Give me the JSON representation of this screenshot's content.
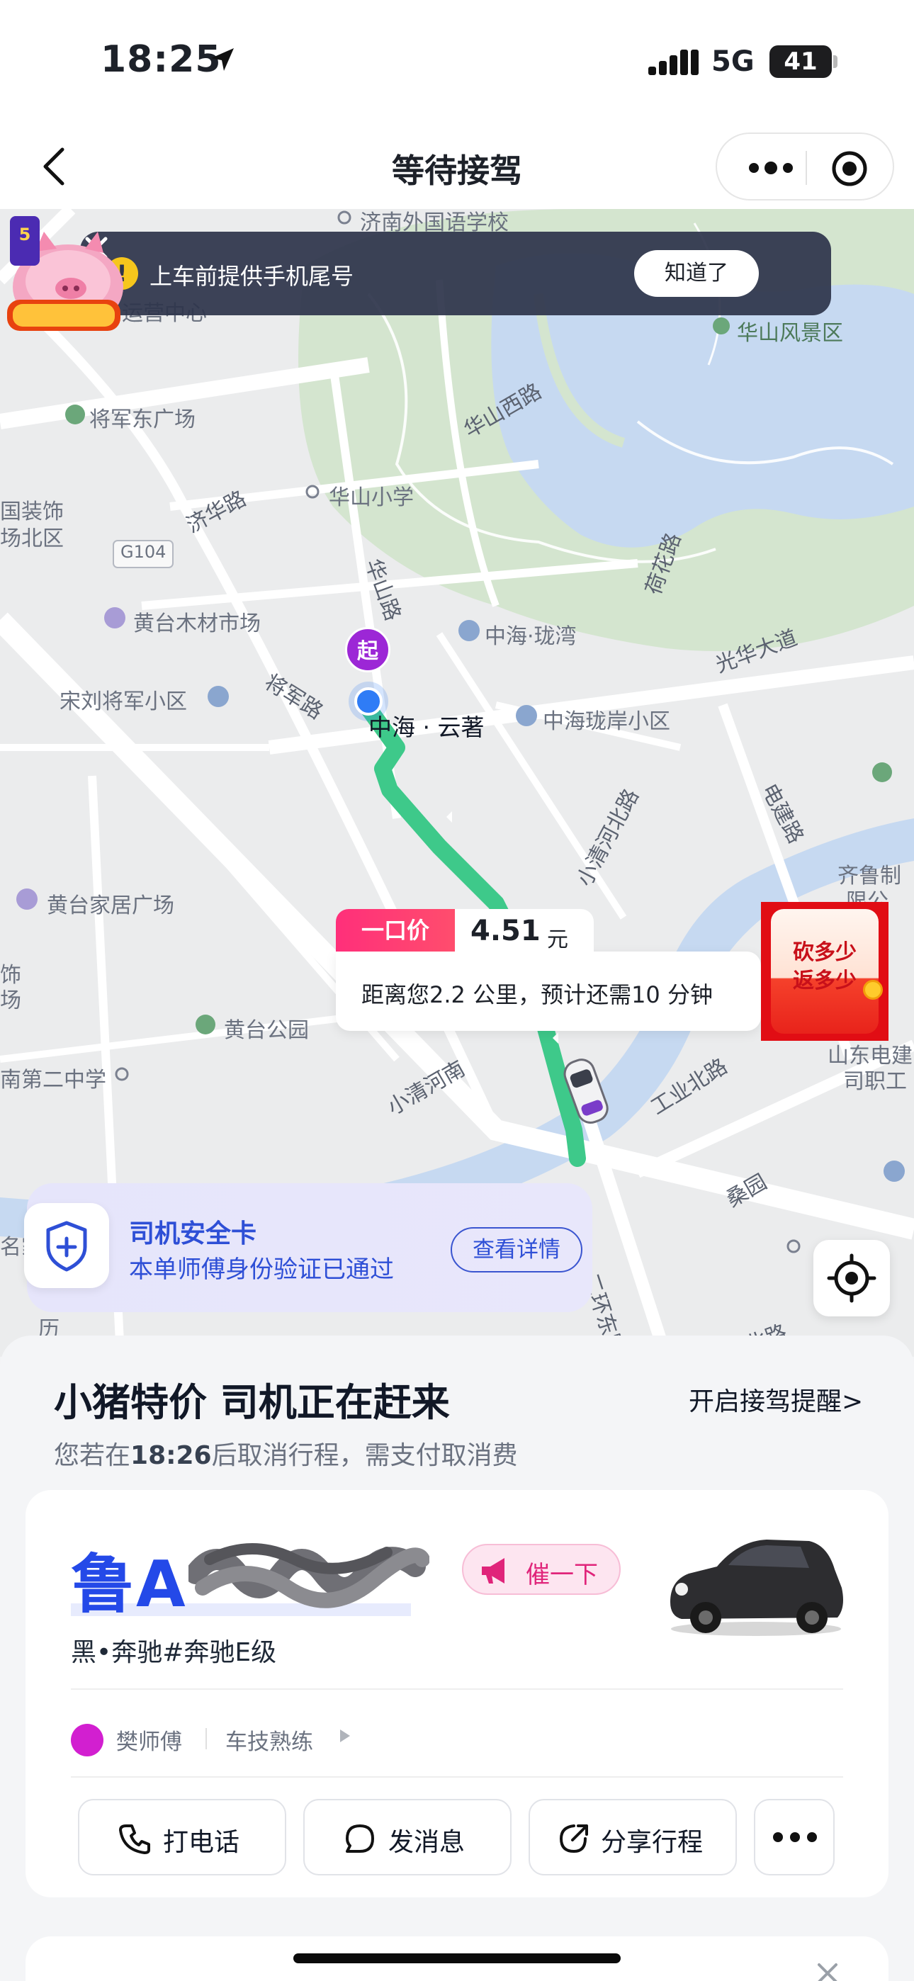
{
  "status_bar": {
    "time": "18:25",
    "network": "5G",
    "battery": "41"
  },
  "nav": {
    "title": "等待接驾",
    "back_icon": "chevron-left-icon",
    "more_icon": "more-dots-icon",
    "close_icon": "target-close-icon"
  },
  "tip": {
    "text": "上车前提供手机尾号",
    "button": "知道了"
  },
  "map": {
    "labels": {
      "school": "济南外国语学校",
      "transport": "运营中心",
      "huashan_scenic": "华山风景区",
      "square": "将军东广场",
      "huashan_west": "华山西路",
      "jihua": "济华路",
      "huashan_school": "华山小学",
      "g104": "G104",
      "equipment": "国装饰",
      "equipment2": "场北区",
      "huangtai_timber": "黄台木材市场",
      "huashan_road": "华山路",
      "zhonghai_longwan": "中海·珑湾",
      "hehua_road": "荷花路",
      "guangda": "光华大道",
      "songliu": "宋刘将军小区",
      "jiangjun_road": "将军路",
      "start_label": "中海 · 云著",
      "zhonghai_anxiao": "中海珑岸小区",
      "xiaoqing": "小清河北路",
      "dianjian": "电建路",
      "qilu": "齐鲁制",
      "qilu2": "限公",
      "huangtai_home": "黄台家居广场",
      "shi": "饰",
      "chang": "场",
      "huangtai_park": "黄台公园",
      "xiaoqing_south": "小清河南",
      "gongye": "工业北路",
      "middle_school": "南第二中学",
      "shandong_elec": "山东电建",
      "shandong_elec2": "司职工",
      "sangyuan": "桑园",
      "huandong": "二环东路",
      "jiayuan": "名家",
      "li": "历",
      "beilu": "北路",
      "start_marker": "起"
    }
  },
  "price": {
    "tag": "一口价",
    "value": "4.51",
    "unit": "元",
    "eta": "距离您2.2 公里，预计还需10 分钟"
  },
  "promo": {
    "line1": "砍多少",
    "line2": "返多少"
  },
  "safety": {
    "title": "司机安全卡",
    "desc": "本单师傅身份验证已通过",
    "button": "查看详情"
  },
  "sheet": {
    "title": "小猪特价 司机正在赶来",
    "remind": "开启接驾提醒>",
    "cancel_prefix": "您若在",
    "cancel_time": "18:26",
    "cancel_suffix": "后取消行程，需支付取消费"
  },
  "driver": {
    "plate": "鲁A ",
    "urge": "催一下",
    "car_desc": "黑•奔驰#奔驰E级",
    "name": "樊师傅",
    "skill": "车技熟练"
  },
  "actions": {
    "call": "打电话",
    "message": "发消息",
    "share": "分享行程"
  },
  "colors": {
    "route": "#3ec98a",
    "accent_blue": "#2449e8",
    "purple": "#9c27d6",
    "urge_pink": "#e0247a"
  }
}
